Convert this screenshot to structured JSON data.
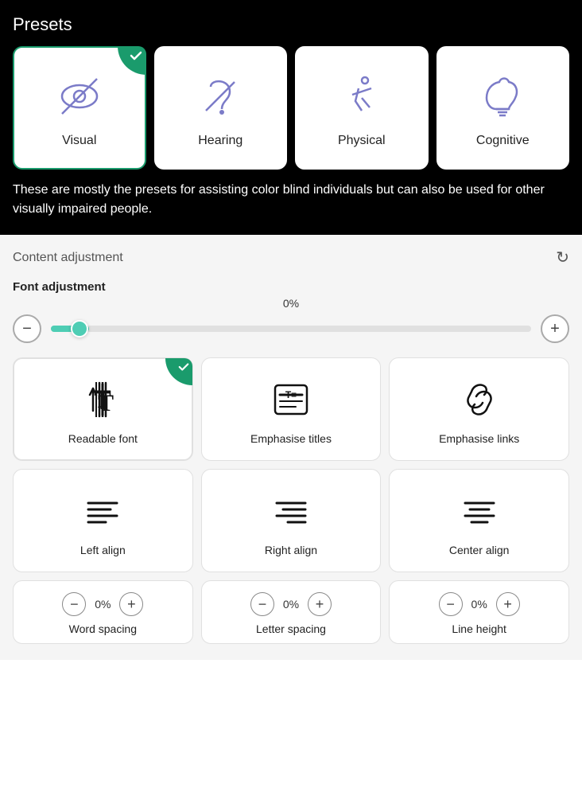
{
  "presets": {
    "title": "Presets",
    "description": "These are mostly the presets for assisting color blind individuals but can also be used for other visually impaired people.",
    "items": [
      {
        "id": "visual",
        "label": "Visual",
        "selected": true
      },
      {
        "id": "hearing",
        "label": "Hearing",
        "selected": false
      },
      {
        "id": "physical",
        "label": "Physical",
        "selected": false
      },
      {
        "id": "cognitive",
        "label": "Cognitive",
        "selected": false
      }
    ]
  },
  "content_adjustment": {
    "title": "Content adjustment",
    "font_adjustment": {
      "label": "Font adjustment",
      "value": "0%"
    },
    "cards": [
      {
        "id": "readable-font",
        "label": "Readable font",
        "selected": true
      },
      {
        "id": "emphasise-titles",
        "label": "Emphasise titles",
        "selected": false
      },
      {
        "id": "emphasise-links",
        "label": "Emphasise links",
        "selected": false
      },
      {
        "id": "left-align",
        "label": "Left align",
        "selected": false
      },
      {
        "id": "right-align",
        "label": "Right align",
        "selected": false
      },
      {
        "id": "center-align",
        "label": "Center align",
        "selected": false
      }
    ],
    "spacing": [
      {
        "id": "word-spacing",
        "label": "Word spacing",
        "value": "0%"
      },
      {
        "id": "letter-spacing",
        "label": "Letter spacing",
        "value": "0%"
      },
      {
        "id": "line-height",
        "label": "Line height",
        "value": "0%"
      }
    ]
  },
  "buttons": {
    "minus": "−",
    "plus": "+"
  }
}
